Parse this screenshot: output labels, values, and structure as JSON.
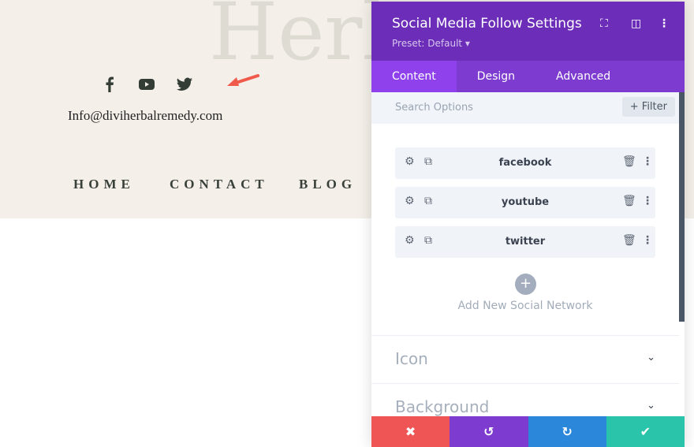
{
  "page": {
    "hero_title": "Herb",
    "email": "Info@diviherbalremedy.com",
    "nav": [
      "HOME",
      "CONTACT",
      "BLOG"
    ],
    "social_icons": [
      "facebook-icon",
      "youtube-icon",
      "twitter-icon"
    ]
  },
  "panel": {
    "title": "Social Media Follow Settings",
    "preset": "Preset: Default ▾",
    "tabs": [
      "Content",
      "Design",
      "Advanced"
    ],
    "search_placeholder": "Search Options",
    "filter_label": "+ Filter",
    "networks": [
      "facebook",
      "youtube",
      "twitter"
    ],
    "add_label": "Add New Social Network",
    "sections": [
      "Icon",
      "Background"
    ],
    "colors": {
      "header": "#6c2eb9",
      "cancel": "#ef5555",
      "undo": "#7e3bd0",
      "redo": "#2b87da",
      "save": "#29c4a9"
    }
  }
}
